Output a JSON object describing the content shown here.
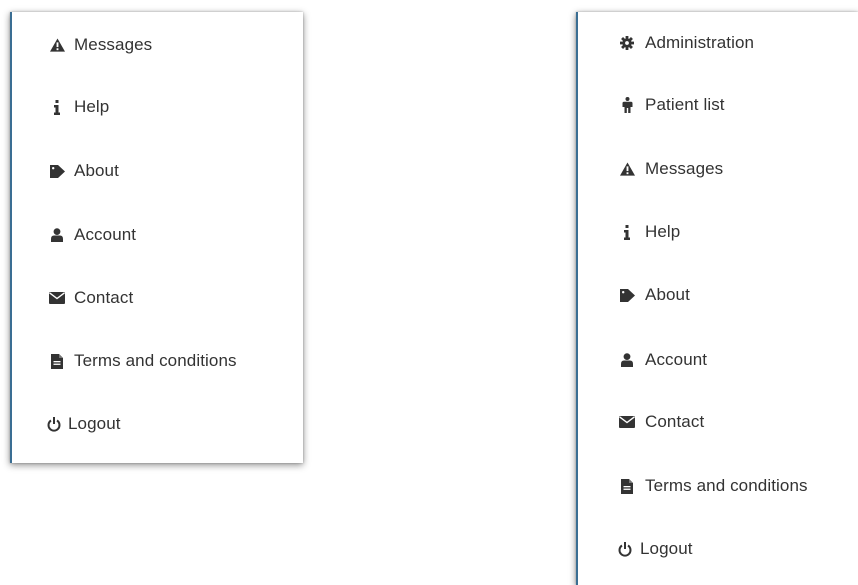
{
  "left_menu": {
    "items": [
      {
        "label": "Messages",
        "icon": "warning-icon"
      },
      {
        "label": "Help",
        "icon": "info-icon"
      },
      {
        "label": "About",
        "icon": "tag-icon"
      },
      {
        "label": "Account",
        "icon": "user-icon"
      },
      {
        "label": "Contact",
        "icon": "envelope-icon"
      },
      {
        "label": "Terms and conditions",
        "icon": "file-text-icon"
      },
      {
        "label": "Logout",
        "icon": "power-icon"
      }
    ]
  },
  "right_menu": {
    "items": [
      {
        "label": "Administration",
        "icon": "gear-icon"
      },
      {
        "label": "Patient list",
        "icon": "person-icon"
      },
      {
        "label": "Messages",
        "icon": "warning-icon"
      },
      {
        "label": "Help",
        "icon": "info-icon"
      },
      {
        "label": "About",
        "icon": "tag-icon"
      },
      {
        "label": "Account",
        "icon": "user-icon"
      },
      {
        "label": "Contact",
        "icon": "envelope-icon"
      },
      {
        "label": "Terms and conditions",
        "icon": "file-text-icon"
      },
      {
        "label": "Logout",
        "icon": "power-icon"
      }
    ]
  },
  "colors": {
    "text": "#333333",
    "panel_border_accent": "#3a6e93",
    "panel_background": "#ffffff"
  }
}
